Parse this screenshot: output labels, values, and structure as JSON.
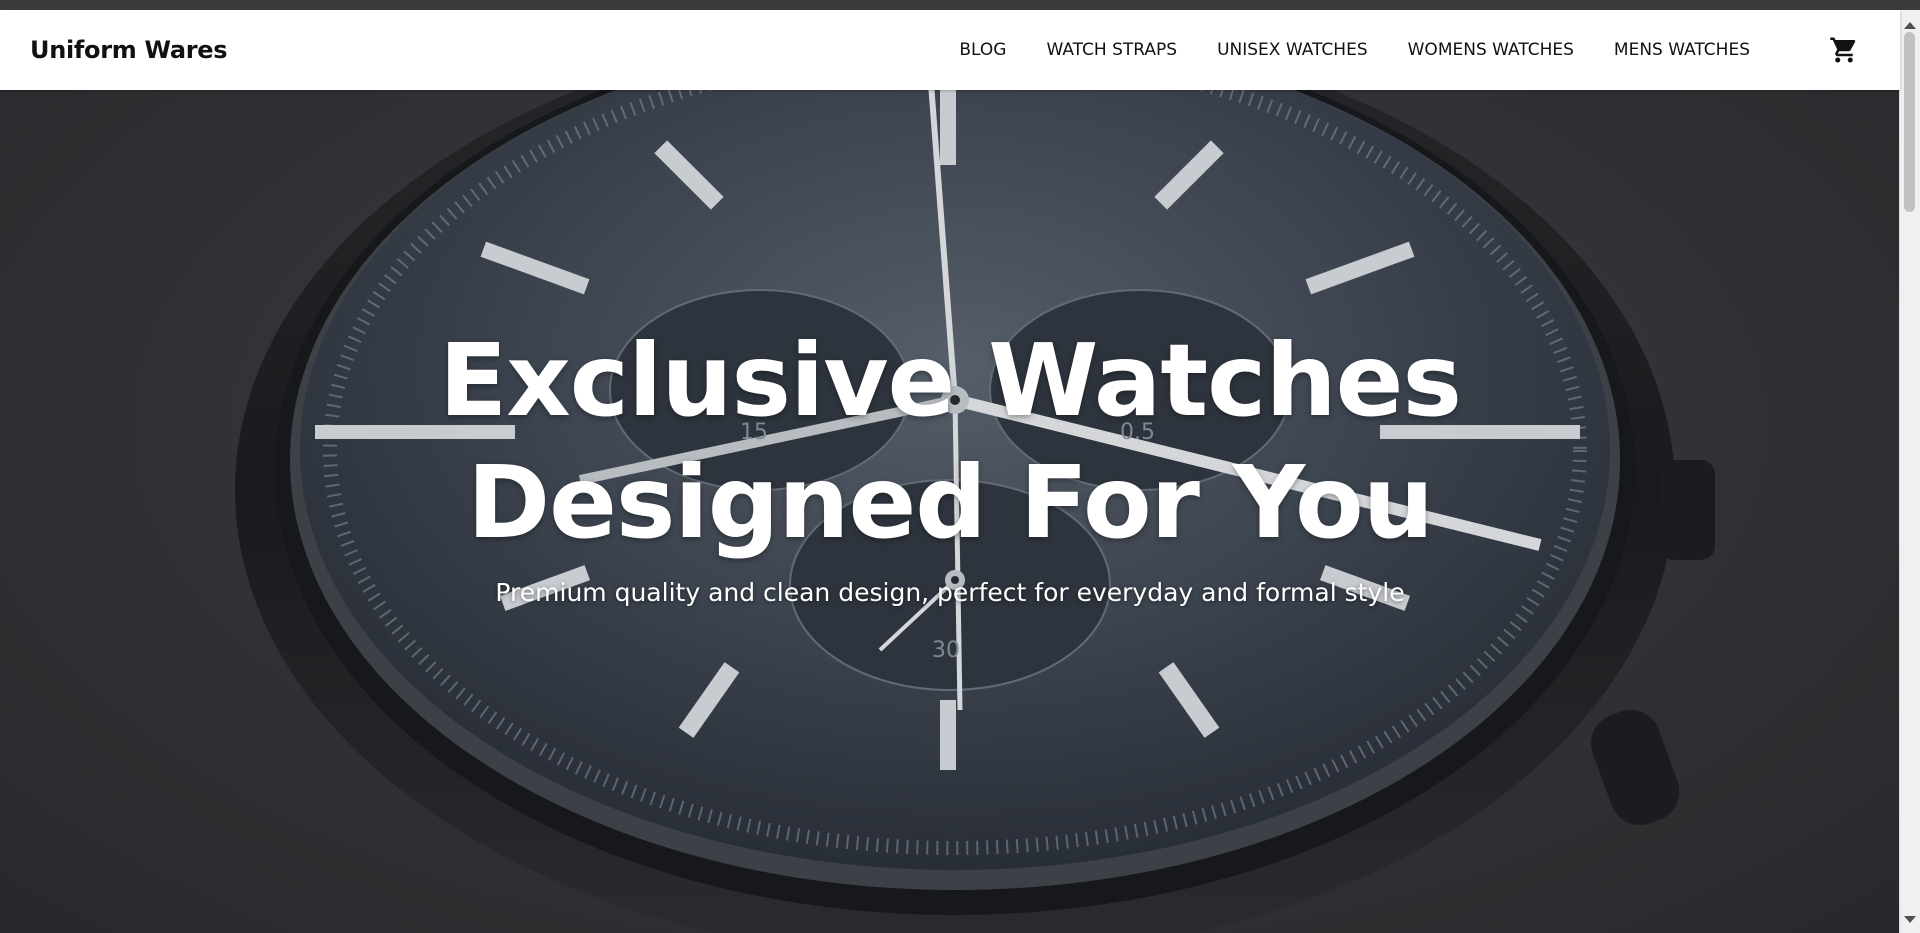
{
  "brand": {
    "name": "Uniform Wares"
  },
  "nav": {
    "items": [
      {
        "label": "BLOG"
      },
      {
        "label": "WATCH STRAPS"
      },
      {
        "label": "UNISEX WATCHES"
      },
      {
        "label": "WOMENS WATCHES"
      },
      {
        "label": "MENS WATCHES"
      }
    ],
    "cart_icon": "shopping-cart-icon"
  },
  "hero": {
    "title_line1": "Exclusive Watches",
    "title_line2": "Designed For You",
    "subtitle": "Premium quality and clean design, perfect for everyday and formal style",
    "dial_numbers": [
      "15",
      "0.5",
      "30"
    ]
  },
  "colors": {
    "navbar_bg": "#ffffff",
    "text_dark": "#111111",
    "hero_text": "#ffffff",
    "dial": "#4b5563"
  }
}
